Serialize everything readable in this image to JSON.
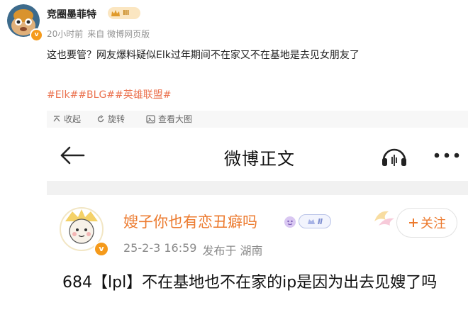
{
  "post": {
    "author": "竞圈墨菲特",
    "level_badge": "Ⅲ",
    "time": "20小时前",
    "source": "来自 微博网页版",
    "text": "这也要管？网友爆料疑似Elk过年期间不在家又不在基地是去见女朋友了",
    "tags": "#Elk##BLG##英雄联盟#"
  },
  "toolbar": {
    "collapse_label": "收起",
    "rotate_label": "旋转",
    "view_large_label": "查看大图"
  },
  "inner": {
    "title": "微博正文",
    "author": "嫂子你也有恋丑癖吗",
    "level_badge": "Ⅱ",
    "time": "25-2-3 16:59",
    "location": "发布于 湖南",
    "follow_label": "关注",
    "text": "684【lpl】不在基地也不在家的ip是因为出去见嫂了吗"
  },
  "colors": {
    "link_orange": "#eb7350",
    "name_orange": "#ec7a2e",
    "verified_badge": "#f59a1b"
  },
  "icons": [
    "back-arrow-icon",
    "headphones-icon",
    "more-icon",
    "collapse-icon",
    "rotate-icon",
    "view-large-icon",
    "verified-icon",
    "plus-icon"
  ]
}
